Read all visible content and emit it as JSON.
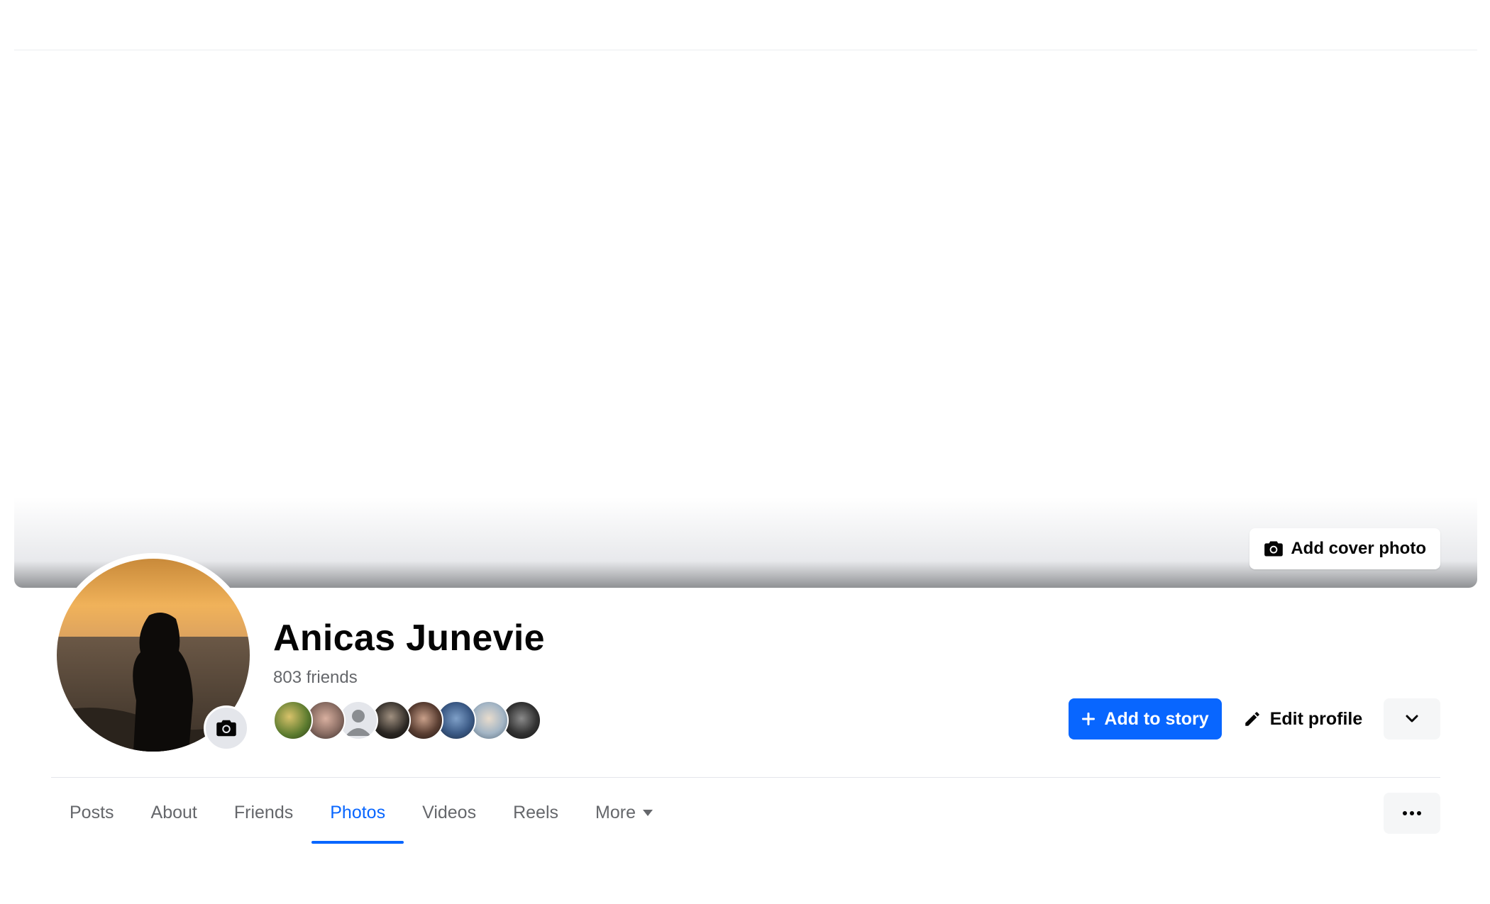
{
  "cover": {
    "add_cover_label": "Add cover photo"
  },
  "profile": {
    "name": "Anicas Junevie",
    "friends_count": "803 friends"
  },
  "actions": {
    "add_story_label": "Add to story",
    "edit_profile_label": "Edit profile"
  },
  "tabs": [
    {
      "label": "Posts"
    },
    {
      "label": "About"
    },
    {
      "label": "Friends"
    },
    {
      "label": "Photos"
    },
    {
      "label": "Videos"
    },
    {
      "label": "Reels"
    },
    {
      "label": "More"
    }
  ],
  "active_tab": "Photos",
  "colors": {
    "accent": "#0866ff",
    "secondary_text": "#65676b",
    "primary_text": "#050505"
  },
  "icons": {
    "camera": "camera-icon",
    "plus": "plus-icon",
    "pencil": "pencil-icon",
    "chevron": "chevron-down-icon",
    "more": "more-horizontal-icon"
  }
}
